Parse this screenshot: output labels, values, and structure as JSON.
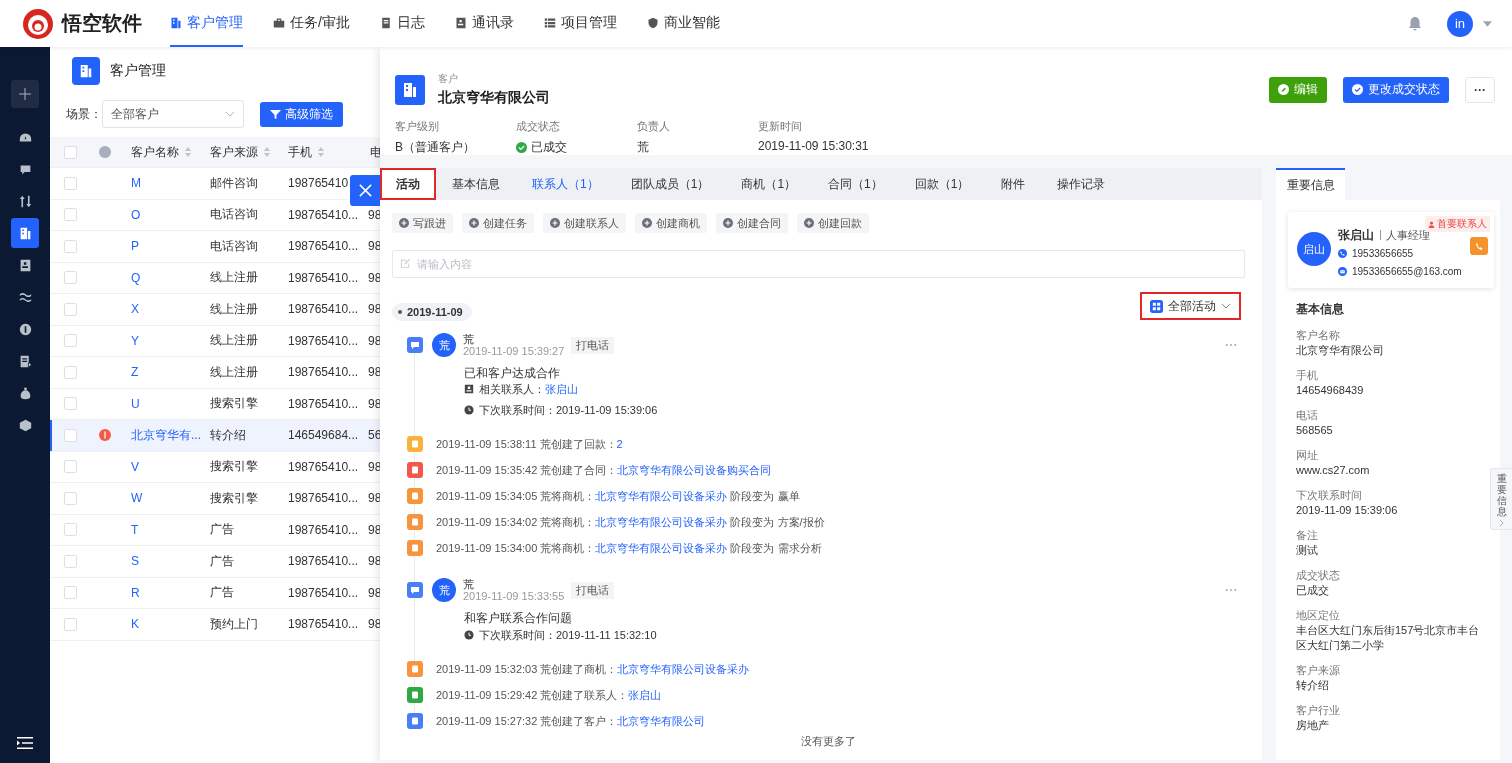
{
  "logo": {
    "text": "悟空软件"
  },
  "nav": [
    {
      "label": "客户管理",
      "selected": true
    },
    {
      "label": "任务/审批",
      "selected": false
    },
    {
      "label": "日志",
      "selected": false
    },
    {
      "label": "通讯录",
      "selected": false
    },
    {
      "label": "项目管理",
      "selected": false
    },
    {
      "label": "商业智能",
      "selected": false
    }
  ],
  "user": {
    "avatar": "in"
  },
  "sidebar": {
    "items": [
      {
        "selected": false
      },
      {
        "selected": false
      },
      {
        "selected": false
      },
      {
        "selected": true
      },
      {
        "selected": false
      },
      {
        "selected": false
      },
      {
        "selected": false
      },
      {
        "selected": false
      },
      {
        "selected": false
      },
      {
        "selected": false
      }
    ]
  },
  "list": {
    "title": "客户管理",
    "scene_label": "场景：",
    "scene_value": "全部客户",
    "filter_button": "高级筛选",
    "all_checked": false,
    "columns": [
      {
        "label": "客户名称",
        "sortable": true
      },
      {
        "label": "客户来源",
        "sortable": true
      },
      {
        "label": "手机",
        "sortable": true
      },
      {
        "label": "电"
      }
    ],
    "rows": [
      {
        "name": "M",
        "source": "邮件咨询",
        "mobile": "198765410",
        "column_4": "",
        "checked": false,
        "selected": false,
        "deal": false
      },
      {
        "name": "O",
        "source": "电话咨询",
        "mobile": "198765410...",
        "column_4": "98",
        "checked": false,
        "selected": false,
        "deal": false
      },
      {
        "name": "P",
        "source": "电话咨询",
        "mobile": "198765410...",
        "column_4": "98",
        "checked": false,
        "selected": false,
        "deal": false
      },
      {
        "name": "Q",
        "source": "线上注册",
        "mobile": "198765410...",
        "column_4": "98",
        "checked": false,
        "selected": false,
        "deal": false
      },
      {
        "name": "X",
        "source": "线上注册",
        "mobile": "198765410...",
        "column_4": "98",
        "checked": false,
        "selected": false,
        "deal": false
      },
      {
        "name": "Y",
        "source": "线上注册",
        "mobile": "198765410...",
        "column_4": "98",
        "checked": false,
        "selected": false,
        "deal": false
      },
      {
        "name": "Z",
        "source": "线上注册",
        "mobile": "198765410...",
        "column_4": "98",
        "checked": false,
        "selected": false,
        "deal": false
      },
      {
        "name": "U",
        "source": "搜索引擎",
        "mobile": "198765410...",
        "column_4": "98",
        "checked": false,
        "selected": false,
        "deal": false
      },
      {
        "name": "北京穹华有...",
        "source": "转介绍",
        "mobile": "146549684...",
        "column_4": "56",
        "checked": false,
        "selected": true,
        "deal": true
      },
      {
        "name": "V",
        "source": "搜索引擎",
        "mobile": "198765410...",
        "column_4": "98",
        "checked": false,
        "selected": false,
        "deal": false
      },
      {
        "name": "W",
        "source": "搜索引擎",
        "mobile": "198765410...",
        "column_4": "98",
        "checked": false,
        "selected": false,
        "deal": false
      },
      {
        "name": "T",
        "source": "广告",
        "mobile": "198765410...",
        "column_4": "98",
        "checked": false,
        "selected": false,
        "deal": false
      },
      {
        "name": "S",
        "source": "广告",
        "mobile": "198765410...",
        "column_4": "98",
        "checked": false,
        "selected": false,
        "deal": false
      },
      {
        "name": "R",
        "source": "广告",
        "mobile": "198765410...",
        "column_4": "98",
        "checked": false,
        "selected": false,
        "deal": false
      },
      {
        "name": "K",
        "source": "预约上门",
        "mobile": "198765410...",
        "column_4": "98",
        "checked": false,
        "selected": false,
        "deal": false
      }
    ]
  },
  "drawer": {
    "type_label": "客户",
    "title": "北京穹华有限公司",
    "buttons": [
      {
        "label": "编辑",
        "kind": "edit"
      },
      {
        "label": "更改成交状态",
        "kind": "status"
      },
      {
        "label": "···",
        "kind": "more"
      }
    ],
    "fields": [
      {
        "label": "客户级别",
        "value": "B（普通客户）",
        "kind": "text"
      },
      {
        "label": "成交状态",
        "value": "已成交",
        "kind": "status"
      },
      {
        "label": "负责人",
        "value": "荒",
        "kind": "text"
      },
      {
        "label": "更新时间",
        "value": "2019-11-09 15:30:31",
        "kind": "text"
      }
    ],
    "tabs": [
      {
        "label": "活动",
        "selected": true,
        "hovered": false,
        "marked": true
      },
      {
        "label": "基本信息",
        "selected": false,
        "hovered": false,
        "marked": false
      },
      {
        "label": "联系人（1）",
        "selected": false,
        "hovered": true,
        "marked": false
      },
      {
        "label": "团队成员（1）",
        "selected": false,
        "hovered": false,
        "marked": false
      },
      {
        "label": "商机（1）",
        "selected": false,
        "hovered": false,
        "marked": false
      },
      {
        "label": "合同（1）",
        "selected": false,
        "hovered": false,
        "marked": false
      },
      {
        "label": "回款（1）",
        "selected": false,
        "hovered": false,
        "marked": false
      },
      {
        "label": "附件",
        "selected": false,
        "hovered": false,
        "marked": false
      },
      {
        "label": "操作记录",
        "selected": false,
        "hovered": false,
        "marked": false
      }
    ],
    "actions": [
      "写跟进",
      "创建任务",
      "创建联系人",
      "创建商机",
      "创建合同",
      "创建回款"
    ],
    "input": {
      "placeholder": "请输入内容"
    },
    "date": "2019-11-09",
    "filter": {
      "label": "全部活动",
      "marked": true
    },
    "timeline": [
      {
        "kind": "followup",
        "avatar": "荒",
        "author": "荒",
        "time": "2019-11-09 15:39:27",
        "tag": "打电话",
        "content": "已和客户达成合作",
        "contact_label": "相关联系人：",
        "contact": "张启山",
        "next_label": "下次联系时间：",
        "next": "2019-11-09 15:39:06"
      },
      {
        "kind": "log",
        "color": "#fbb23c",
        "text": "2019-11-09 15:38:11 荒创建了回款：",
        "link": "2"
      },
      {
        "kind": "log",
        "color": "#f4574b",
        "text": "2019-11-09 15:35:42 荒创建了合同：",
        "link": "北京穹华有限公司设备购买合同"
      },
      {
        "kind": "log",
        "color": "#f7943c",
        "text": "2019-11-09 15:34:05 荒将商机：",
        "link": "北京穹华有限公司设备采办",
        "suffix": " 阶段变为 赢单"
      },
      {
        "kind": "log",
        "color": "#f7943c",
        "text": "2019-11-09 15:34:02 荒将商机：",
        "link": "北京穹华有限公司设备采办",
        "suffix": " 阶段变为 方案/报价"
      },
      {
        "kind": "log",
        "color": "#f7943c",
        "text": "2019-11-09 15:34:00 荒将商机：",
        "link": "北京穹华有限公司设备采办",
        "suffix": " 阶段变为 需求分析"
      },
      {
        "kind": "followup",
        "avatar": "荒",
        "author": "荒",
        "time": "2019-11-09 15:33:55",
        "tag": "打电话",
        "content": "和客户联系合作问题",
        "next_label": "下次联系时间：",
        "next": "2019-11-11 15:32:10"
      },
      {
        "kind": "log",
        "color": "#f7943c",
        "text": "2019-11-09 15:32:03 荒创建了商机：",
        "link": "北京穹华有限公司设备采办"
      },
      {
        "kind": "log",
        "color": "#2fa845",
        "text": "2019-11-09 15:29:42 荒创建了联系人：",
        "link": "张启山"
      },
      {
        "kind": "log",
        "color": "#4a7ef6",
        "text": "2019-11-09 15:27:32 荒创建了客户：",
        "link": "北京穹华有限公司"
      }
    ],
    "end_text": "没有更多了"
  },
  "info_panel": {
    "tab": {
      "label": "重要信息",
      "selected": true
    },
    "contact": {
      "avatar": "启山",
      "name": "张启山",
      "role": "人事经理",
      "badge": "首要联系人",
      "phone": "19533656655",
      "email": "19533656655@163.com"
    },
    "section_title": "基本信息",
    "fields": [
      {
        "label": "客户名称",
        "value": "北京穹华有限公司"
      },
      {
        "label": "手机",
        "value": "14654968439"
      },
      {
        "label": "电话",
        "value": "568565"
      },
      {
        "label": "网址",
        "value": "www.cs27.com"
      },
      {
        "label": "下次联系时间",
        "value": "2019-11-09 15:39:06"
      },
      {
        "label": "备注",
        "value": "测试"
      },
      {
        "label": "成交状态",
        "value": "已成交"
      },
      {
        "label": "地区定位",
        "value": "丰台区大红门东后街157号北京市丰台区大红门第二小学"
      },
      {
        "label": "客户来源",
        "value": "转介绍"
      },
      {
        "label": "客户行业",
        "value": "房地产"
      }
    ]
  },
  "side_tab": {
    "label": "重要信息"
  }
}
